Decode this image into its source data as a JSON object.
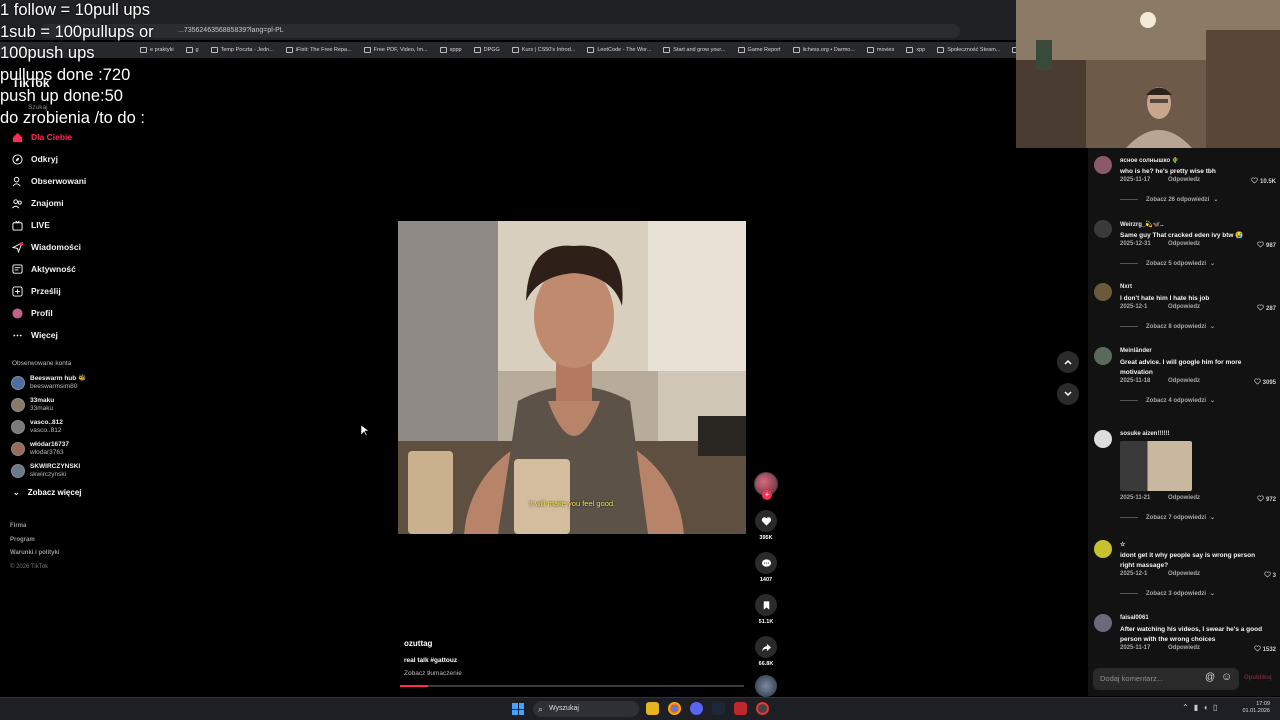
{
  "overlay_lines": [
    "1 follow = 10pull ups",
    "1sub = 100pullups or",
    "100push ups",
    "pullups done :720",
    "push up done:50",
    "do zrobienia /to do :"
  ],
  "browser": {
    "url": "...7356246356885839?lang=pl-PL",
    "bookmarks": [
      "e praktyki",
      "g",
      "Temp Poczta - Jedn...",
      "iFixit: The Free Repa...",
      "Free PDF, Video, Im...",
      "xppp",
      "DPGG",
      "Kurs | CS50's Introd...",
      "LeetCode - The Wor...",
      "Start and grow your...",
      "Game Report",
      "lichess.org • Darmo...",
      "movies",
      "xpp",
      "Społeczność Steam...",
      "noway"
    ]
  },
  "tiktok": {
    "logo": "TikTok",
    "search_placeholder": "Szukaj",
    "nav": [
      {
        "label": "Dla Ciebie",
        "icon": "home-icon",
        "active": true
      },
      {
        "label": "Odkryj",
        "icon": "compass-icon",
        "active": false
      },
      {
        "label": "Obserwowani",
        "icon": "following-icon",
        "active": false
      },
      {
        "label": "Znajomi",
        "icon": "friends-icon",
        "active": false
      },
      {
        "label": "LIVE",
        "icon": "live-icon",
        "active": false
      },
      {
        "label": "Wiadomości",
        "icon": "messages-icon",
        "active": false
      },
      {
        "label": "Aktywność",
        "icon": "activity-icon",
        "active": false
      },
      {
        "label": "Prześlij",
        "icon": "upload-icon",
        "active": false
      },
      {
        "label": "Profil",
        "icon": "profile-icon",
        "active": false
      },
      {
        "label": "Więcej",
        "icon": "more-icon",
        "active": false
      }
    ],
    "followed_title": "Obserwowane konta",
    "followed": [
      {
        "name": "Beeswarm hub 🐝",
        "handle": "beeswarmsim80"
      },
      {
        "name": "33maku",
        "handle": "33maku"
      },
      {
        "name": "vasco..812",
        "handle": "vasco..812"
      },
      {
        "name": "włódar16737",
        "handle": "wlodar3763"
      },
      {
        "name": "SKWIRCZYNSKI",
        "handle": "skwirczynski"
      }
    ],
    "see_more": "Zobacz więcej",
    "footer": [
      "Firma",
      "Program",
      "Warunki i polityki"
    ],
    "copyright": "© 2026 TikTok"
  },
  "video": {
    "subtitle": "It will make you feel good.",
    "author": "ozuttag",
    "description": "real talk #gattouz",
    "translate": "Zobacz tłumaczenie",
    "progress": 0.08,
    "likes": "395K",
    "comments": "1407",
    "saves": "51.1K",
    "shares": "66.8K"
  },
  "comments": [
    {
      "user": "ясное солнышко 🌵",
      "text": "who is he? he's pretty wise tbh",
      "date": "2025-11-17",
      "likes": "10.5K",
      "more": "Zobacz 26 odpowiedzi"
    },
    {
      "user": "Weirzrg_💫🦋..",
      "text": "Same guy That cracked eden ivy btw 😭",
      "date": "2025-12-31",
      "likes": "987",
      "more": "Zobacz 5 odpowiedzi"
    },
    {
      "user": "Nxrt",
      "text": "I don't hate him I hate his job",
      "date": "2025-12-1",
      "likes": "287",
      "more": "Zobacz 8 odpowiedzi"
    },
    {
      "user": "Meinländer",
      "text": "Great advice. I will google him for more motivation",
      "date": "2025-11-18",
      "likes": "3095",
      "more": "Zobacz 4 odpowiedzi"
    },
    {
      "user": "sosuke aizen!!!!!!",
      "text": "",
      "date": "2025-11-21",
      "likes": "972",
      "more": "Zobacz 7 odpowiedzi"
    },
    {
      "user": "☆",
      "text": "idont get it why people say is wrong person right massage?",
      "date": "2025-12-1",
      "likes": "3",
      "more": "Zobacz 3 odpowiedzi"
    },
    {
      "user": "faisal0061",
      "text": "After watching his videos, I swear he's a good person with the wrong choices",
      "date": "2025-11-17",
      "likes": "1532",
      "more": ""
    }
  ],
  "reply_label": "Odpowiedz",
  "comment_input_placeholder": "Dodaj komentarz...",
  "comment_at": "@",
  "comment_post": "Opublikuj",
  "taskbar": {
    "search": "Wyszukaj",
    "time": "17:09",
    "date": "01.01.2026"
  },
  "colors": {
    "accent": "#fe2c55",
    "subtitle": "#f2e04a"
  }
}
